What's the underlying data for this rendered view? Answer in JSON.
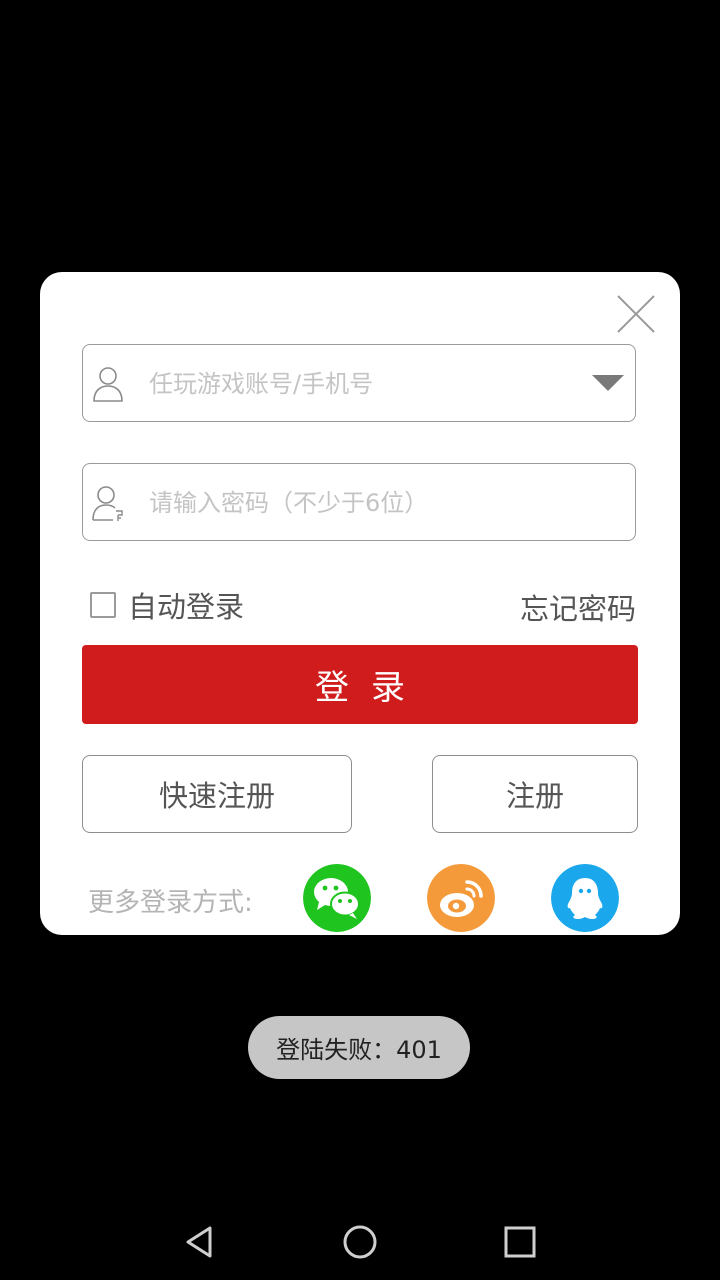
{
  "login_dialog": {
    "account": {
      "placeholder": "任玩游戏账号/手机号",
      "value": ""
    },
    "password": {
      "placeholder": "请输入密码（不少于6位）",
      "value": ""
    },
    "auto_login_label": "自动登录",
    "auto_login_checked": false,
    "forgot_password_label": "忘记密码",
    "login_button_label": "登录",
    "quick_register_label": "快速注册",
    "register_label": "注册",
    "more_login_label": "更多登录方式:",
    "social_logins": [
      "wechat-icon",
      "weibo-icon",
      "qq-icon"
    ],
    "colors": {
      "login_button": "#d01c1c",
      "wechat": "#1fc41f",
      "weibo": "#f59a3b",
      "qq": "#1aa7ec"
    }
  },
  "toast": {
    "message": "登陆失败：401"
  },
  "nav_bar": {
    "buttons": [
      "back-icon",
      "home-icon",
      "recent-apps-icon"
    ]
  }
}
